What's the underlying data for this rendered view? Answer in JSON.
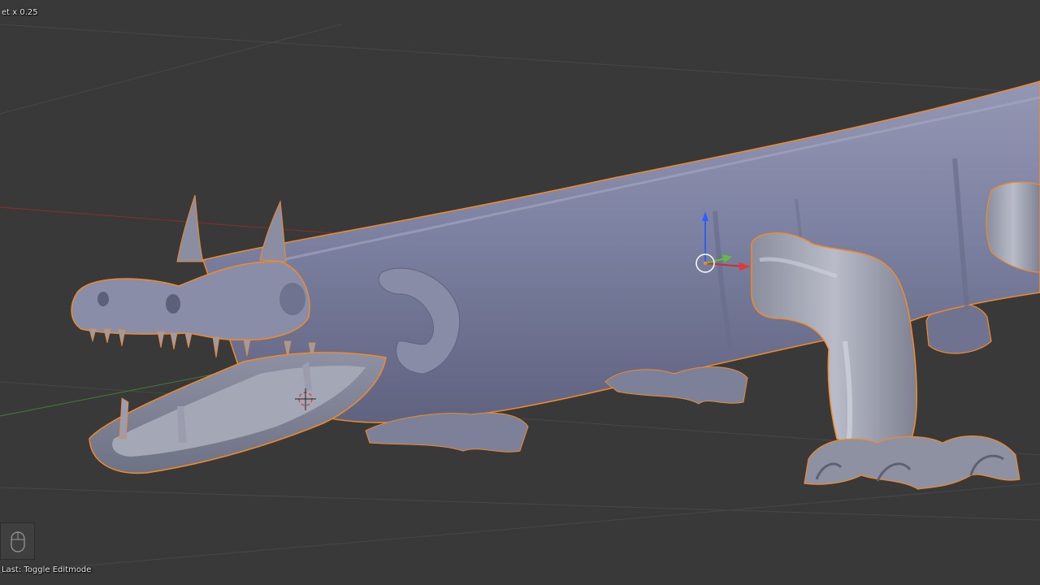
{
  "viewport": {
    "top_overlay_text": "et x 0.25",
    "last_operator": "Last: Toggle Editmode",
    "background_color": "#393939",
    "mesh_color": "#7f83a3",
    "selection_outline_color": "#f08a2a",
    "axis_x_color": "#c9302e",
    "axis_y_color": "#5fbf3a",
    "axis_z_color": "#2d5fff",
    "icons": [
      "mouse-icon",
      "transform-manipulator-icon",
      "3d-cursor-icon"
    ]
  }
}
